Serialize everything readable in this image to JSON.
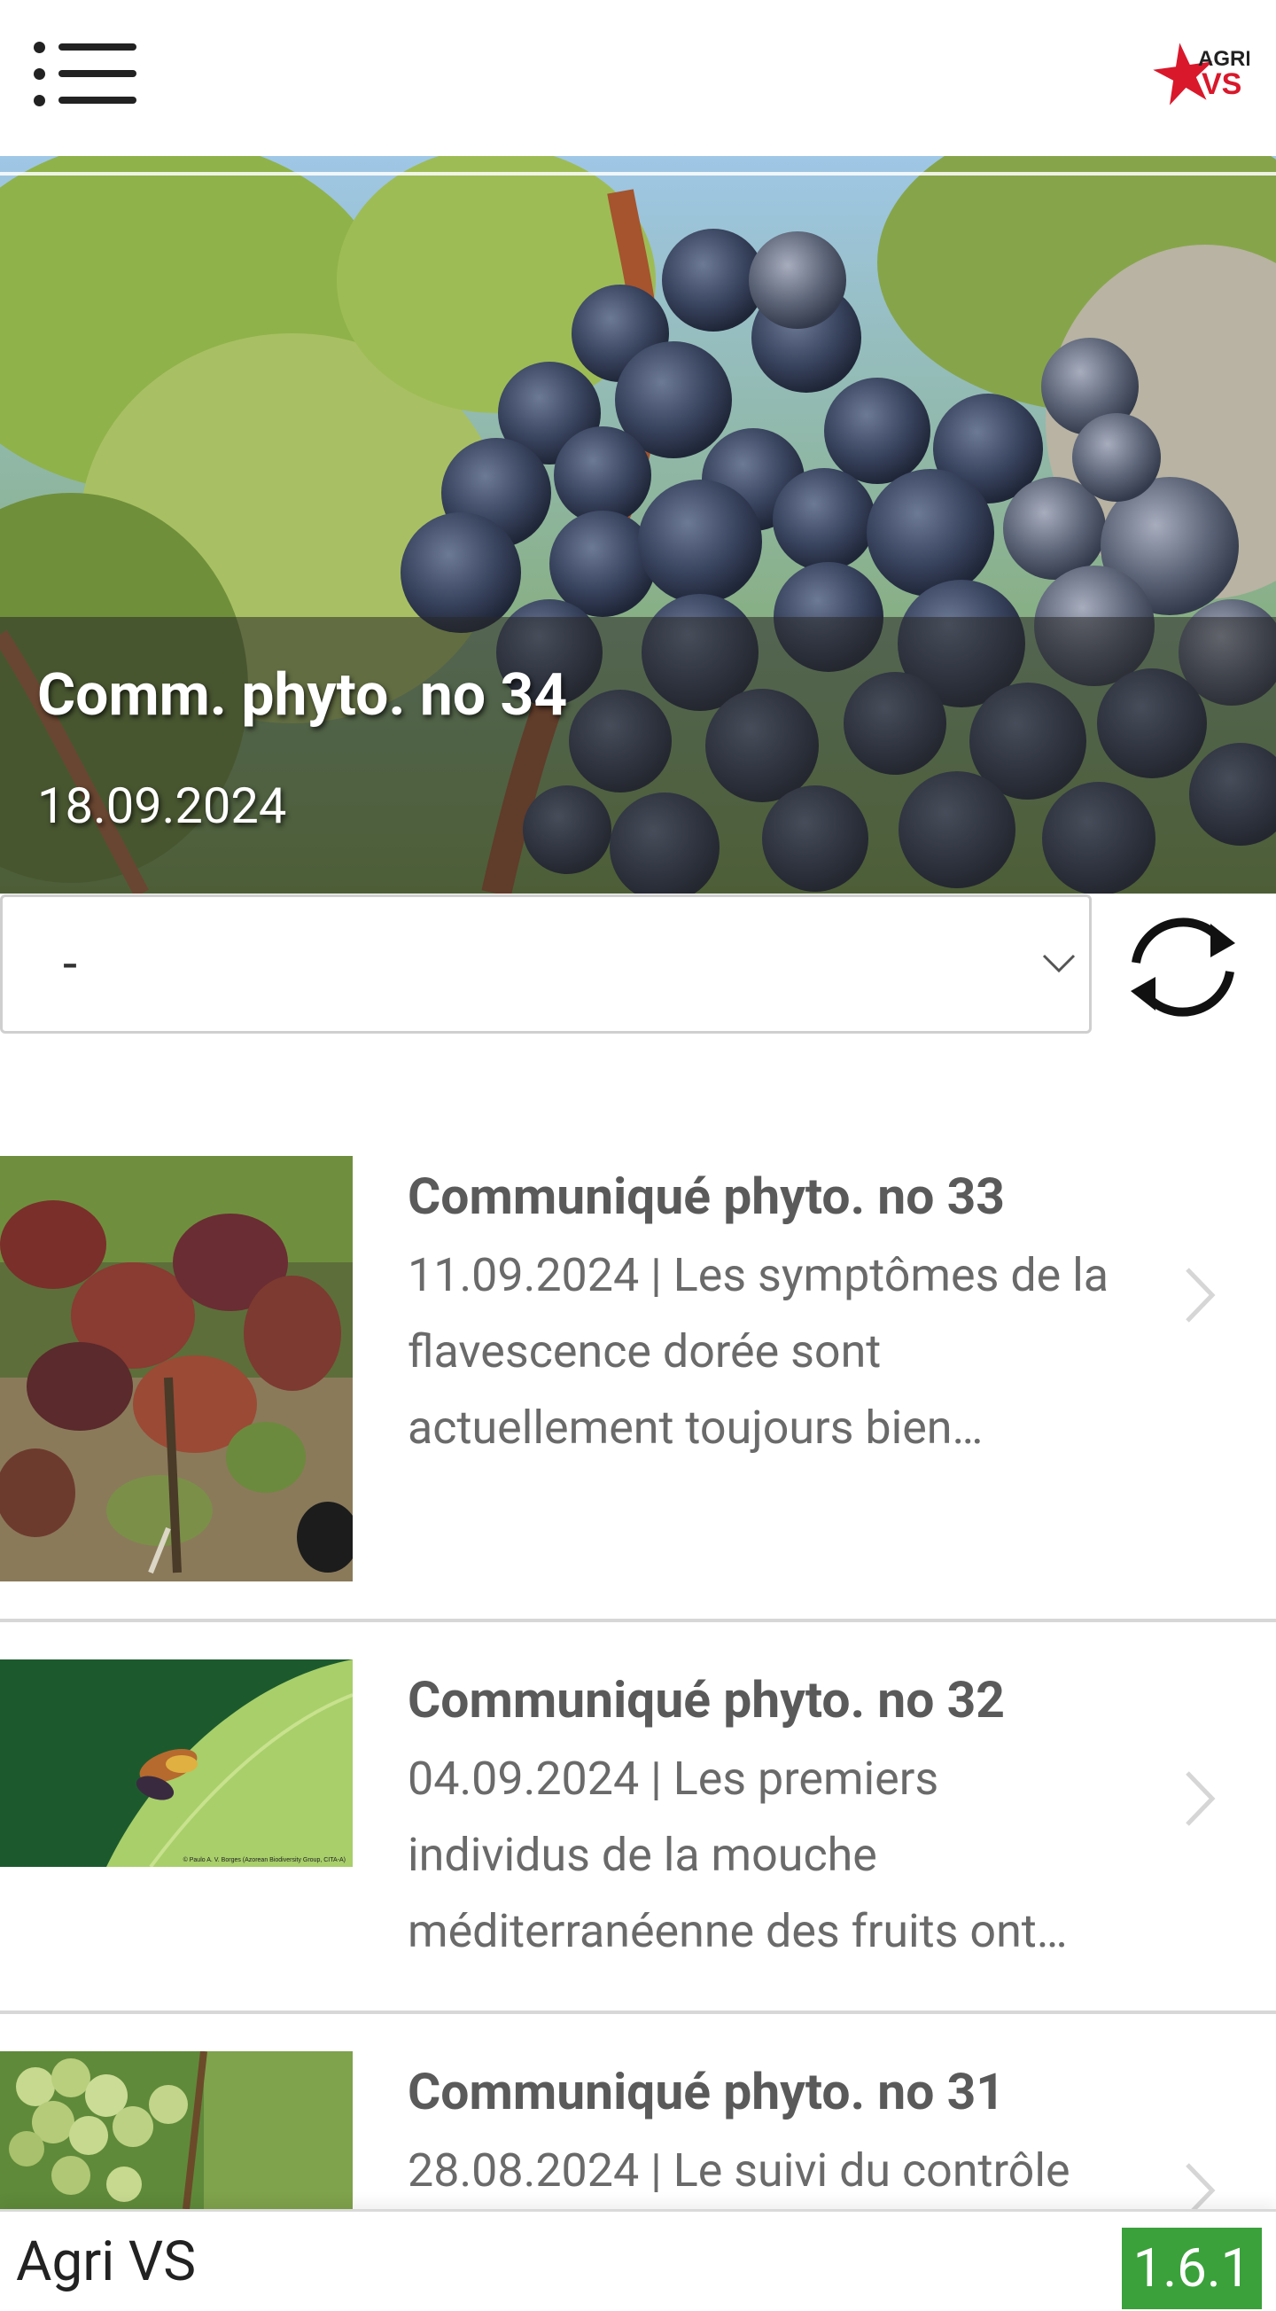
{
  "header": {
    "menu_icon": "hamburger-list-icon",
    "logo": {
      "line1": "AGRI",
      "line2": "VS",
      "star_color": "#d9182b",
      "text_color": "#d9182b"
    }
  },
  "hero": {
    "title": "Comm. phyto. no 34",
    "date": "18.09.2024"
  },
  "filter": {
    "selected_value": "-",
    "refresh_icon": "refresh-icon"
  },
  "items": [
    {
      "title": "Communiqué phyto. no 33",
      "desc_line1": "11.09.2024 | Les symptômes de la",
      "desc_line2": "flavescence dorée sont",
      "desc_line3": "actuellement toujours bien…"
    },
    {
      "title": "Communiqué phyto. no 32",
      "desc_line1": "04.09.2024 | Les premiers",
      "desc_line2": "individus de la mouche",
      "desc_line3": "méditerranéenne des fruits ont…",
      "photo_credit": "© Paulo A. V. Borges (Azorean Biodiversity Group, CITA-A)"
    },
    {
      "title": "Communiqué phyto. no 31",
      "desc_line1": "28.08.2024 | Le suivi du contrôle"
    }
  ],
  "footer": {
    "app_name": "Agri VS",
    "version": "1.6.1",
    "version_color": "#3aa13b"
  }
}
